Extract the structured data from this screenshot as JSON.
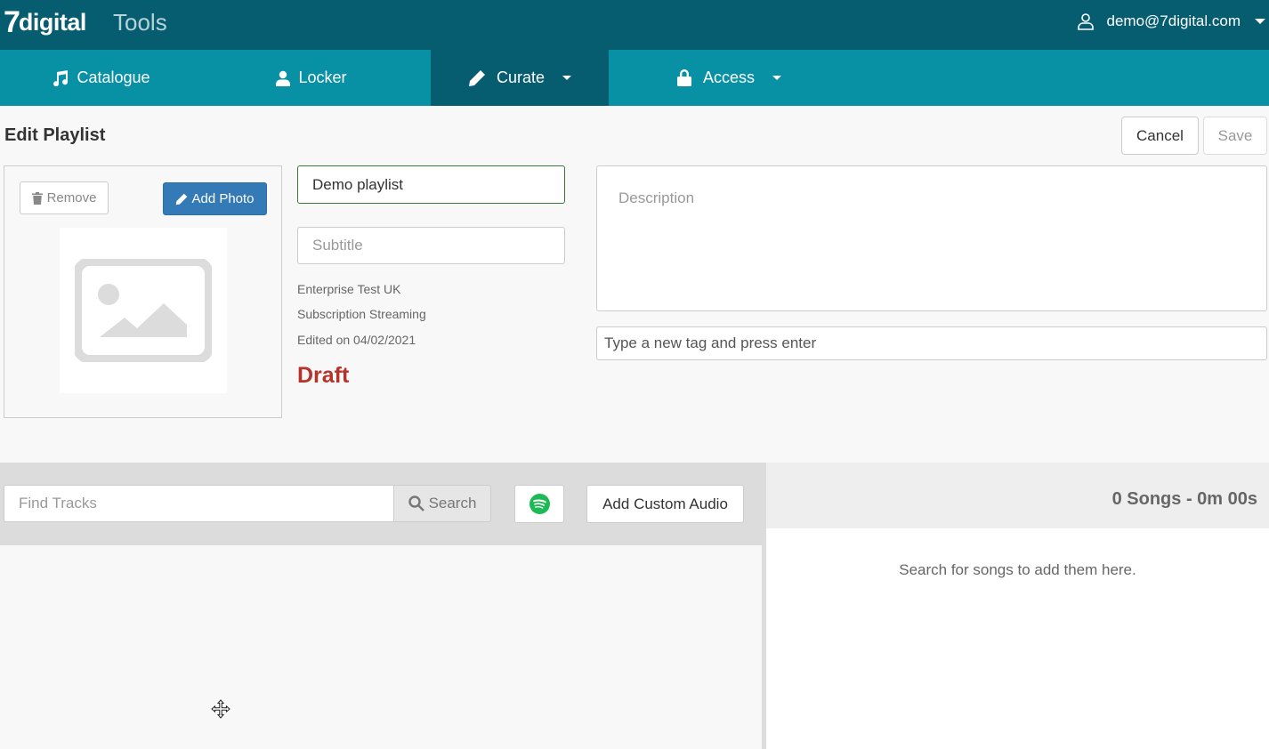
{
  "header": {
    "logo_number": "7",
    "logo_word": "digital",
    "app_name": "Tools",
    "user_email": "demo@7digital.com"
  },
  "nav": {
    "items": [
      {
        "label": "Catalogue",
        "icon": "music-note-icon"
      },
      {
        "label": "Locker",
        "icon": "user-icon"
      },
      {
        "label": "Curate",
        "icon": "pencil-icon",
        "active": true,
        "dropdown": true
      },
      {
        "label": "Access",
        "icon": "lock-icon",
        "dropdown": true
      }
    ]
  },
  "page": {
    "title": "Edit Playlist",
    "cancel_label": "Cancel",
    "save_label": "Save"
  },
  "photo": {
    "remove_label": "Remove",
    "add_label": "Add Photo"
  },
  "form": {
    "name_value": "Demo playlist",
    "subtitle_placeholder": "Subtitle",
    "description_placeholder": "Description",
    "tag_placeholder": "Type a new tag and press enter"
  },
  "meta": {
    "enterprise": "Enterprise Test UK",
    "service": "Subscription Streaming",
    "edited": "Edited on 04/02/2021",
    "status": "Draft"
  },
  "search": {
    "placeholder": "Find Tracks",
    "button_label": "Search",
    "custom_audio_label": "Add Custom Audio"
  },
  "playlist": {
    "summary": "0 Songs - 0m 00s",
    "empty_message": "Search for songs to add them here."
  },
  "colors": {
    "header_bg": "#075d70",
    "nav_bg": "#0891a5",
    "primary_button": "#337ab7",
    "draft_status": "#b5332a",
    "spotify_green": "#1db954"
  }
}
